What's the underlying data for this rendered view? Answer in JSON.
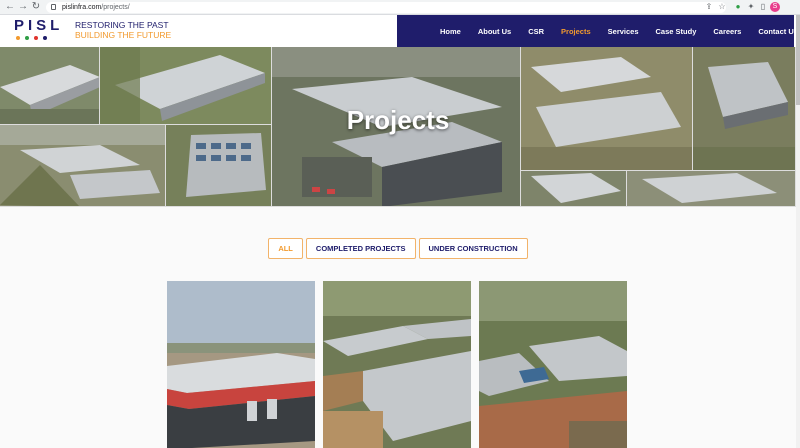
{
  "browser": {
    "url_domain": "pislinfra.com",
    "url_path": "/projects/",
    "profile_initial": "S",
    "icons": [
      "back-icon",
      "forward-icon",
      "reload-icon",
      "lock-icon",
      "share-icon",
      "star-icon",
      "extension-icon",
      "puzzle-icon",
      "sidebar-icon"
    ]
  },
  "header": {
    "logo_text": "PISL",
    "logo_dot_colors": [
      "#f29a2e",
      "#2e9e45",
      "#e0342e",
      "#1f1d6b"
    ],
    "tagline_line1": "RESTORING THE PAST",
    "tagline_line2": "BUILDING THE FUTURE"
  },
  "nav": {
    "items": [
      {
        "label": "Home"
      },
      {
        "label": "About Us"
      },
      {
        "label": "CSR"
      },
      {
        "label": "Projects"
      },
      {
        "label": "Services"
      },
      {
        "label": "Case Study"
      },
      {
        "label": "Careers"
      },
      {
        "label": "Contact Us"
      }
    ],
    "active": "Projects"
  },
  "hero": {
    "title": "Projects"
  },
  "filters": {
    "items": [
      {
        "label": "ALL"
      },
      {
        "label": "COMPLETED PROJECTS"
      },
      {
        "label": "UNDER CONSTRUCTION"
      }
    ],
    "active": "ALL"
  },
  "colors": {
    "brand_navy": "#1f1d6b",
    "brand_orange": "#f29a2e"
  }
}
